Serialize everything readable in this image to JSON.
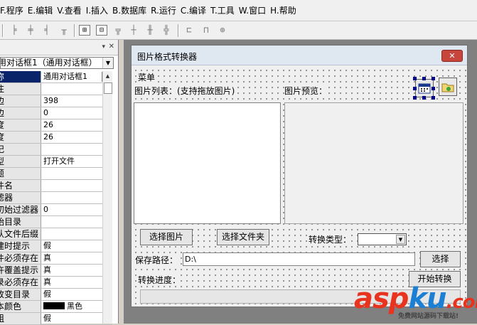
{
  "menu": [
    "F.程序",
    "E.编辑",
    "V.查看",
    "I.插入",
    "B.数据库",
    "R.运行",
    "C.编译",
    "T.工具",
    "W.窗口",
    "H.帮助"
  ],
  "toolbar_icons": [
    "align-left-icon",
    "align-center-icon",
    "align-right-icon",
    "align-top-icon",
    "align-middle-icon",
    "align-bottom-icon",
    "same-width-icon",
    "same-height-icon",
    "same-size-icon",
    "space-horizontal-icon",
    "space-vertical-icon",
    "center-horizontal-icon",
    "center-vertical-icon",
    "center-both-icon"
  ],
  "props": {
    "selector": "用对话框1（通用对话框）",
    "rows": [
      {
        "key": "称",
        "value": "通用对话框1"
      },
      {
        "key": "注",
        "value": ""
      },
      {
        "key": "边",
        "value": "398"
      },
      {
        "key": "边",
        "value": "0"
      },
      {
        "key": "度",
        "value": "26"
      },
      {
        "key": "度",
        "value": "26"
      },
      {
        "key": "记",
        "value": ""
      },
      {
        "key": "型",
        "value": "打开文件"
      },
      {
        "key": "题",
        "value": ""
      },
      {
        "key": "件名",
        "value": ""
      },
      {
        "key": "滤器",
        "value": ""
      },
      {
        "key": "初始过滤器",
        "value": "0"
      },
      {
        "key": "始目录",
        "value": ""
      },
      {
        "key": "认文件后缀",
        "value": ""
      },
      {
        "key": "建时提示",
        "value": "假"
      },
      {
        "key": "件必须存在",
        "value": "真"
      },
      {
        "key": "许覆盖提示",
        "value": "真"
      },
      {
        "key": "录必须存在",
        "value": "真"
      },
      {
        "key": "改变目录",
        "value": "假"
      },
      {
        "key": "本颜色",
        "value": "黑色"
      },
      {
        "key": "粗",
        "value": "假"
      }
    ],
    "text_color_swatch": "#000000"
  },
  "form": {
    "title": "图片格式转换器",
    "menu_label": "菜单",
    "list_label": "图片列表：(支持拖放图片)",
    "preview_label": "图片预览：",
    "btn_select_image": "选择图片",
    "btn_select_folder": "选择文件夹",
    "convert_type_label": "转换类型：",
    "save_path_label": "保存路径：",
    "save_path_value": "D:\\",
    "btn_choose": "选择",
    "progress_label": "转换进度：",
    "btn_start": "开始转换"
  },
  "watermark": {
    "main_a": "asp",
    "main_b": "ku",
    "main_c": ".com",
    "sub": "免费网站源码下载站!"
  }
}
